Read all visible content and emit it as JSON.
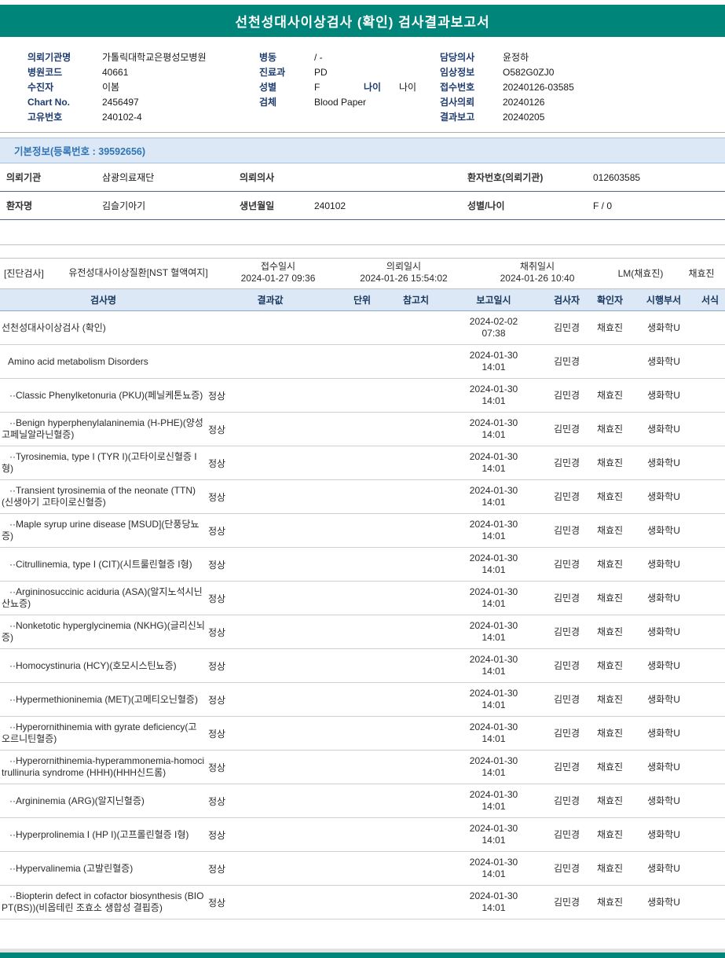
{
  "theme": {
    "teal": "#00857A",
    "navy_label": "#1F3C6E",
    "section_blue": "#2E74B5",
    "section_bg": "#DCE8F5",
    "table_header_text": "#17365D",
    "grid_line": "#CFCFCF",
    "blue_line": "#8FA8C8"
  },
  "title": "선천성대사이상검사 (확인) 검사결과보고서",
  "header_info": {
    "col1": [
      {
        "label": "의뢰기관명",
        "value": "가톨릭대학교은평성모병원"
      },
      {
        "label": "병원코드",
        "value": "40661"
      },
      {
        "label": "수진자",
        "value": "이봄"
      },
      {
        "label": "Chart No.",
        "value": "2456497"
      },
      {
        "label": "고유번호",
        "value": "240102-4"
      }
    ],
    "col2": [
      {
        "label": "병동",
        "value": "/ -"
      },
      {
        "label": "진료과",
        "value": "PD"
      },
      {
        "label": "성별",
        "value": "F",
        "label2": "나이",
        "value2": "나이"
      },
      {
        "label": "검체",
        "value": "Blood Paper"
      }
    ],
    "col3": [
      {
        "label": "담당의사",
        "value": "윤정하"
      },
      {
        "label": "임상정보",
        "value": "O582G0ZJ0"
      },
      {
        "label": "접수번호",
        "value": "20240126-03585"
      },
      {
        "label": "검사의뢰",
        "value": "20240126"
      },
      {
        "label": "결과보고",
        "value": "20240205"
      }
    ]
  },
  "basic_info": {
    "section_title": "기본정보(등록번호 : 39592656)",
    "rows": [
      {
        "pairs": [
          {
            "label": "의뢰기관",
            "value": "삼광의료재단"
          },
          {
            "label": "의뢰의사",
            "value": ""
          },
          {
            "label": "환자번호(의뢰기관)",
            "value": "012603585"
          }
        ]
      },
      {
        "pairs": [
          {
            "label": "환자명",
            "value": "김슬기아기"
          },
          {
            "label": "생년월일",
            "value": "240102"
          },
          {
            "label": "성별/나이",
            "value": "F / 0"
          }
        ]
      }
    ]
  },
  "diagnosis": {
    "tag": "[진단검사]",
    "group": "유전성대사이상질환[NST 혈액여지]",
    "times": [
      {
        "label": "접수일시",
        "value": "2024-01-27 09:36"
      },
      {
        "label": "의뢰일시",
        "value": "2024-01-26 15:54:02"
      },
      {
        "label": "채취일시",
        "value": "2024-01-26 10:40"
      }
    ],
    "collector": "LM(채효진)",
    "confirmer": "채효진"
  },
  "results": {
    "headers": [
      "검사명",
      "결과값",
      "단위",
      "참고치",
      "보고일시",
      "검사자",
      "확인자",
      "시행부서",
      "서식"
    ],
    "rows": [
      {
        "name": "선천성대사이상검사 (확인)",
        "level": 0,
        "result": "",
        "reported": "2024-02-02 07:38",
        "tester": "김민경",
        "confirmer": "채효진",
        "dept": "생화학U"
      },
      {
        "name": "Amino acid metabolism Disorders",
        "level": 1,
        "result": "",
        "reported": "2024-01-30 14:01",
        "tester": "김민경",
        "confirmer": "",
        "dept": "생화학U"
      },
      {
        "name": "··Classic Phenylketonuria (PKU)(페닐케톤뇨증)",
        "level": 2,
        "result": "정상",
        "reported": "2024-01-30 14:01",
        "tester": "김민경",
        "confirmer": "채효진",
        "dept": "생화학U"
      },
      {
        "name": "··Benign hyperphenylalaninemia (H-PHE)(양성 고페닐알라닌혈증)",
        "level": 2,
        "result": "정상",
        "reported": "2024-01-30 14:01",
        "tester": "김민경",
        "confirmer": "채효진",
        "dept": "생화학U"
      },
      {
        "name": "··Tyrosinemia, type I (TYR I)(고타이로신혈증 I형)",
        "level": 2,
        "result": "정상",
        "reported": "2024-01-30 14:01",
        "tester": "김민경",
        "confirmer": "채효진",
        "dept": "생화학U"
      },
      {
        "name": "··Transient tyrosinemia of the neonate (TTN)(신생아기 고타이로신혈증)",
        "level": 2,
        "result": "정상",
        "reported": "2024-01-30 14:01",
        "tester": "김민경",
        "confirmer": "채효진",
        "dept": "생화학U"
      },
      {
        "name": "··Maple syrup urine disease [MSUD](단풍당뇨증)",
        "level": 2,
        "result": "정상",
        "reported": "2024-01-30 14:01",
        "tester": "김민경",
        "confirmer": "채효진",
        "dept": "생화학U"
      },
      {
        "name": "··Citrullinemia, type I (CIT)(시트룰린혈증 I형)",
        "level": 2,
        "result": "정상",
        "reported": "2024-01-30 14:01",
        "tester": "김민경",
        "confirmer": "채효진",
        "dept": "생화학U"
      },
      {
        "name": "··Argininosuccinic aciduria (ASA)(알지노석시닌산뇨증)",
        "level": 2,
        "result": "정상",
        "reported": "2024-01-30 14:01",
        "tester": "김민경",
        "confirmer": "채효진",
        "dept": "생화학U"
      },
      {
        "name": "··Nonketotic hyperglycinemia (NKHG)(글리신뇌증)",
        "level": 2,
        "result": "정상",
        "reported": "2024-01-30 14:01",
        "tester": "김민경",
        "confirmer": "채효진",
        "dept": "생화학U"
      },
      {
        "name": "··Homocystinuria (HCY)(호모시스틴뇨증)",
        "level": 2,
        "result": "정상",
        "reported": "2024-01-30 14:01",
        "tester": "김민경",
        "confirmer": "채효진",
        "dept": "생화학U"
      },
      {
        "name": "··Hypermethioninemia (MET)(고메티오닌혈증)",
        "level": 2,
        "result": "정상",
        "reported": "2024-01-30 14:01",
        "tester": "김민경",
        "confirmer": "채효진",
        "dept": "생화학U"
      },
      {
        "name": "··Hyperornithinemia with gyrate deficiency(고오르니틴혈증)",
        "level": 2,
        "result": "정상",
        "reported": "2024-01-30 14:01",
        "tester": "김민경",
        "confirmer": "채효진",
        "dept": "생화학U"
      },
      {
        "name": "··Hyperornithinemia-hyperammonemia-homocitrullinuria syndrome (HHH)(HHH신드롬)",
        "level": 2,
        "result": "정상",
        "reported": "2024-01-30 14:01",
        "tester": "김민경",
        "confirmer": "채효진",
        "dept": "생화학U"
      },
      {
        "name": "··Argininemia (ARG)(알지닌혈증)",
        "level": 2,
        "result": "정상",
        "reported": "2024-01-30 14:01",
        "tester": "김민경",
        "confirmer": "채효진",
        "dept": "생화학U"
      },
      {
        "name": "··Hyperprolinemia I (HP I)(고프롤린혈증 I형)",
        "level": 2,
        "result": "정상",
        "reported": "2024-01-30 14:01",
        "tester": "김민경",
        "confirmer": "채효진",
        "dept": "생화학U"
      },
      {
        "name": "··Hypervalinemia (고발린혈증)",
        "level": 2,
        "result": "정상",
        "reported": "2024-01-30 14:01",
        "tester": "김민경",
        "confirmer": "채효진",
        "dept": "생화학U"
      },
      {
        "name": "··Biopterin defect in cofactor biosynthesis (BIOPT(BS))(비옵테린 조효소 생합성 결핍증)",
        "level": 2,
        "result": "정상",
        "reported": "2024-01-30 14:01",
        "tester": "김민경",
        "confirmer": "채효진",
        "dept": "생화학U"
      }
    ]
  }
}
